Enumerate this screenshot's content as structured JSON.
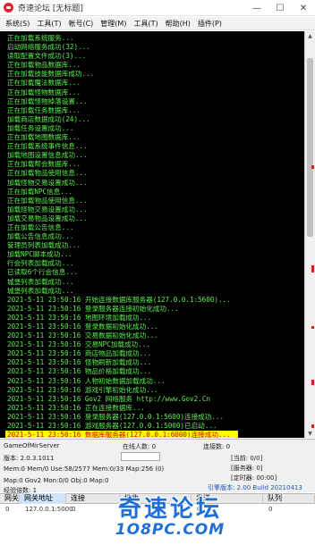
{
  "window": {
    "title": "奇速论坛 [无标题]",
    "minimize_label": "—",
    "maximize_label": "☐",
    "close_label": "✕"
  },
  "menu": [
    {
      "label": "系统(S)"
    },
    {
      "label": "工具(T)"
    },
    {
      "label": "帐号(C)"
    },
    {
      "label": "管理(M)"
    },
    {
      "label": "工具(T)"
    },
    {
      "label": "帮助(H)"
    },
    {
      "label": "插件(P)"
    }
  ],
  "console": {
    "lines": [
      {
        "text": "正在加载系统服务...",
        "hl": false
      },
      {
        "text": "启动网络服务成功(32)...",
        "hl": false
      },
      {
        "text": "读取配置文件成功(3)...",
        "hl": false
      },
      {
        "text": "正在加载物品数据库...",
        "hl": false
      },
      {
        "text": "正在加载技能数据库成功...",
        "hl": false
      },
      {
        "text": "正在加载魔法数据库...",
        "hl": false
      },
      {
        "text": "正在加载怪物数据库...",
        "hl": false
      },
      {
        "text": "正在加载怪物掉落设置...",
        "hl": false
      },
      {
        "text": "正在加载任务数据库...",
        "hl": false
      },
      {
        "text": "加载商店数据成功(24)...",
        "hl": false
      },
      {
        "text": "加载任务设置成功...",
        "hl": false
      },
      {
        "text": "正在加载地图数据库...",
        "hl": false
      },
      {
        "text": "正在加载系统事件信息...",
        "hl": false
      },
      {
        "text": "加载地图设置信息成功...",
        "hl": false
      },
      {
        "text": "正在加载帮会数据库...",
        "hl": false
      },
      {
        "text": "正在加载物品使用信息...",
        "hl": false
      },
      {
        "text": "加载怪物交易设置成功...",
        "hl": false
      },
      {
        "text": "正在加载NPC信息...",
        "hl": false
      },
      {
        "text": "正在加载物品使用信息...",
        "hl": false
      },
      {
        "text": "加载怪物交易设置成功...",
        "hl": false
      },
      {
        "text": "加载交易物品设置成功...",
        "hl": false
      },
      {
        "text": "正在加载公告信息...",
        "hl": false
      },
      {
        "text": "加载公告信息成功...",
        "hl": false
      },
      {
        "text": "管理员列表加载成功...",
        "hl": false
      },
      {
        "text": "加载NPC脚本成功...",
        "hl": false
      },
      {
        "text": "行会列表加载成功...",
        "hl": false
      },
      {
        "text": "已读取6个行会信息...",
        "hl": false
      },
      {
        "text": "城堡列表加载成功...",
        "hl": false
      },
      {
        "text": "城堡列表加载成功...",
        "hl": false
      },
      {
        "text": "2021-5-11 23:50:16 开始连接数据库服务器(127.0.0.1:5600)...",
        "hl": false
      },
      {
        "text": "2021-5-11 23:50:16 登录服务器连接初始化成功...",
        "hl": false
      },
      {
        "text": "2021-5-11 23:50:16 地图环境加载成功...",
        "hl": false
      },
      {
        "text": "2021-5-11 23:50:16 登录数据初始化成功...",
        "hl": false
      },
      {
        "text": "2021-5-11 23:50:16 交易数据初始化成功...",
        "hl": false
      },
      {
        "text": "2021-5-11 23:50:16 交易NPC加载成功...",
        "hl": false
      },
      {
        "text": "2021-5-11 23:50:16 商店物品加载成功...",
        "hl": false
      },
      {
        "text": "2021-5-11 23:50:16 怪物刷新加载成功...",
        "hl": false
      },
      {
        "text": "2021-5-11 23:50:16 物品价格加载成功...",
        "hl": false
      },
      {
        "text": "2021-5-11 23:50:16 人物初始数据加载成功...",
        "hl": false
      },
      {
        "text": "2021-5-11 23:50:16 游戏引擎初始化成功...",
        "hl": false
      },
      {
        "text": "2021-5-11 23:50:16 Gov2 网络服务 http://www.Gov2.Cn",
        "hl": false
      },
      {
        "text": "2021-5-11 23:50:16 正在连接数据库...",
        "hl": false
      },
      {
        "text": "2021-5-11 23:50:16 登录服务器(127.0.0.1:5600)连接成功...",
        "hl": false
      },
      {
        "text": "2021-5-11 23:50:16 游戏服务器(127.0.0.1:5000)已启动...",
        "hl": false
      },
      {
        "text": "2021-5-11 23:50:16 数据库服务器(127.0.0.1:6000)连接成功...",
        "hl": true
      },
      {
        "text": "2021-5-11 23:50:16 数据库服务器已连接...允许客户端连接...",
        "hl": true
      },
      {
        "text": "2021-5-11 23:50:16 数据库服务器(127.0.0.1:6000)连接成功...",
        "hl": false
      }
    ]
  },
  "status": {
    "engine": "GameOfMirServer",
    "version_line": "版本: 2.0.3.1011",
    "online_label": "在线人数: 0",
    "connections_label": "连接数: 0",
    "memory_line": "Mem:0 Mem/0 Use:58/2577 Mem:0/33 Map:256 (0)",
    "map_status": "Map:0 Gov2 Mon:0/0 Obj:0 Map:0",
    "exp_label": "经验倍数: 1",
    "level_label": "[当前: 0/0]",
    "server_label": "[服务器: 0]",
    "timer_label": "[定时器: 00:00]",
    "version_right": "引擎版本: 2.00 Build 20210413"
  },
  "grid": {
    "headers": [
      "网关",
      "网关地址",
      "连接",
      "接收",
      "发送",
      "队列"
    ],
    "rows": [
      [
        "0",
        "127.0.0.1:5000",
        "0",
        "0",
        "0",
        "0"
      ]
    ]
  },
  "watermark": {
    "title": "奇速论坛",
    "url": "1O8PC.COM"
  },
  "colors": {
    "console_bg": "#000000",
    "console_text": "#59f04c",
    "highlight_bg": "#ffff00",
    "highlight_text": "#d40000",
    "accent_blue": "#1e6fd6"
  }
}
